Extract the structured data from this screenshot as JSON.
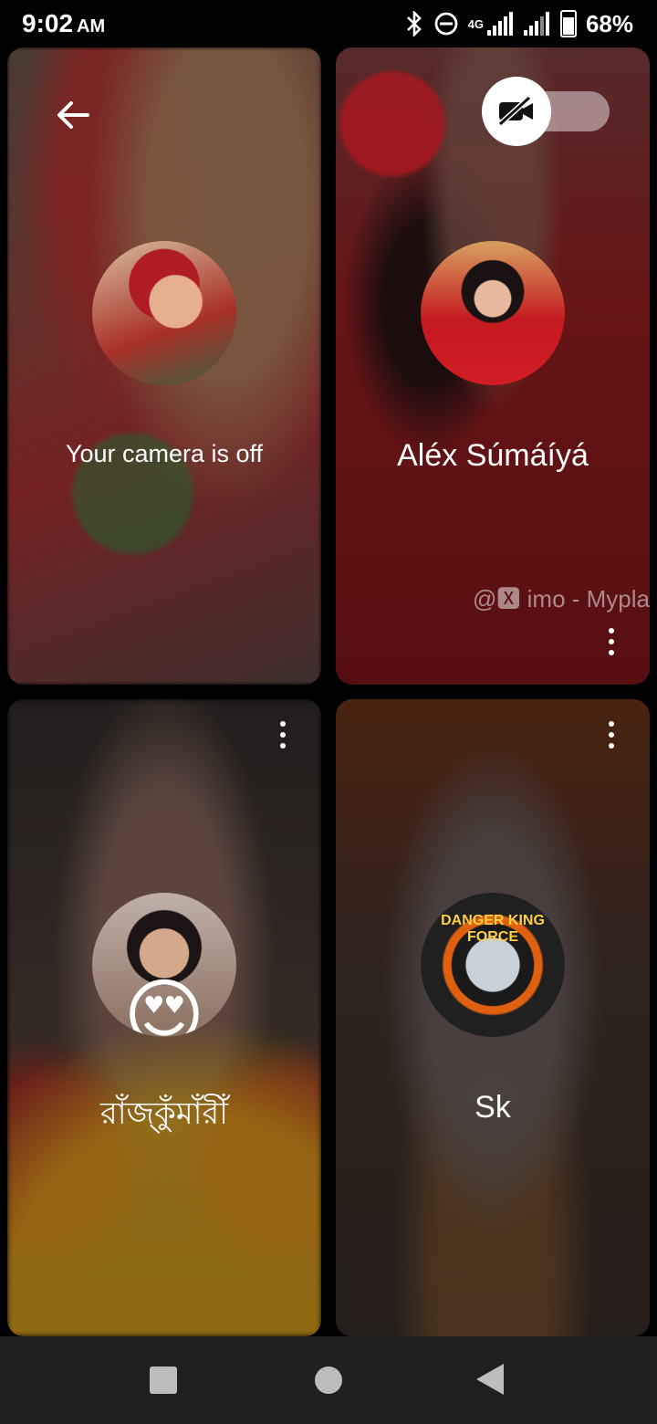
{
  "status_bar": {
    "time": "9:02",
    "am_pm": "AM",
    "network": "4G",
    "battery": "68%"
  },
  "tiles": [
    {
      "avatar_icon": "user-photo-avatar",
      "caption": "Your camera is off"
    },
    {
      "avatar_icon": "user-photo-avatar",
      "name": "Aléx Súmáíyá",
      "watermark": "@🆇 imo - Mypla"
    },
    {
      "avatar_icon": "user-photo-avatar",
      "name": "রাঁজ্কুঁমাঁরীঁ"
    },
    {
      "avatar_icon": "user-photo-avatar",
      "avatar_badge_text": "DANGER KING FORCE",
      "name": "Sk"
    }
  ],
  "controls": {
    "back_icon": "arrow-left-icon",
    "camera_toggle_icon": "video-off-icon",
    "more_icon": "more-vertical-icon"
  },
  "nav_bar": {
    "recents_icon": "square-icon",
    "home_icon": "circle-icon",
    "back_icon": "triangle-back-icon"
  }
}
